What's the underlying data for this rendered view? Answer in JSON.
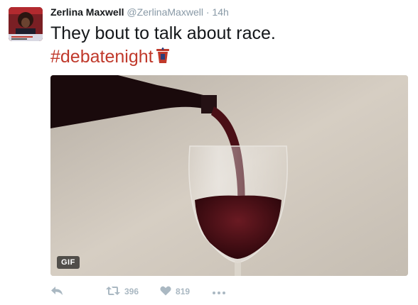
{
  "user": {
    "fullname": "Zerlina Maxwell",
    "screen_name": "@ZerlinaMaxwell",
    "separator": "·",
    "time": "14h"
  },
  "tweet": {
    "text": "They bout to talk about race.",
    "hashtag": "#debatenight"
  },
  "media": {
    "badge": "GIF"
  },
  "actions": {
    "retweet_count": "396",
    "like_count": "819"
  },
  "icons": {
    "reply": "reply-icon",
    "retweet": "retweet-icon",
    "like": "heart-icon",
    "more": "more-icon",
    "hashtag_emoji": "podium-icon"
  },
  "colors": {
    "hashtag": "#c0392b",
    "muted": "#8899a6",
    "action": "#aab8c2",
    "wine": "#4a0f16"
  }
}
